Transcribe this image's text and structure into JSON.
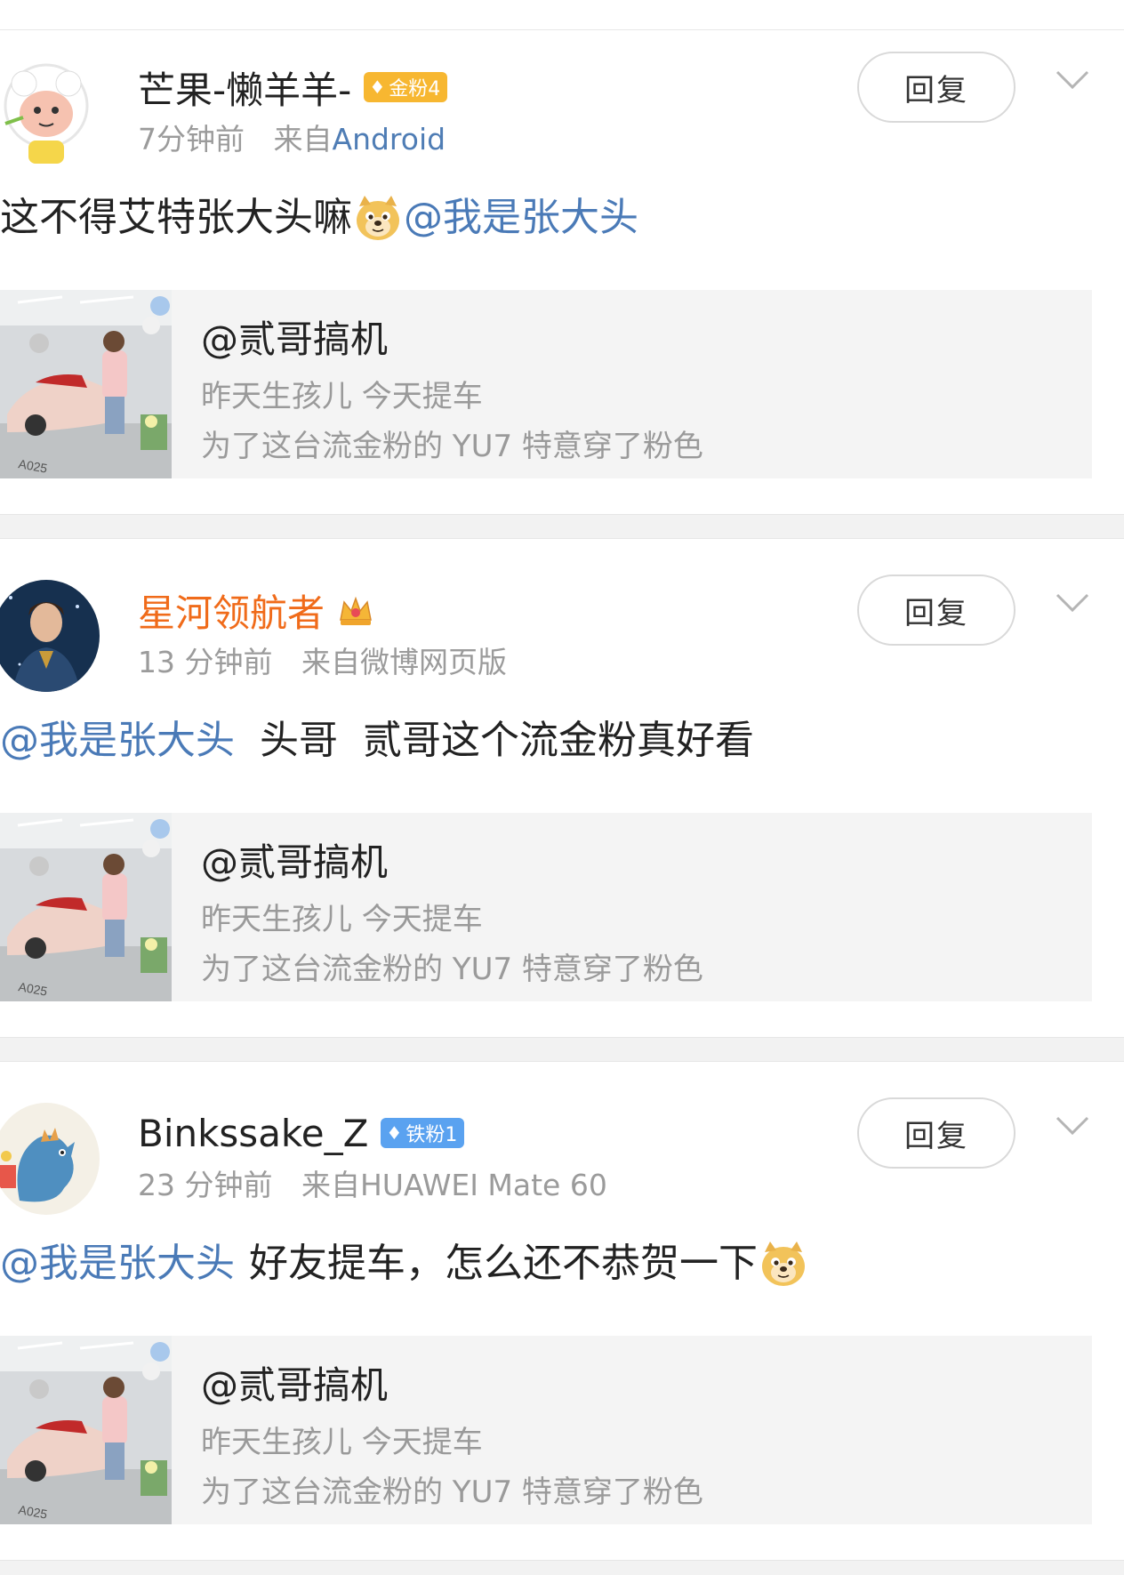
{
  "comments": [
    {
      "username": "芒果-懒羊羊-",
      "badge": "金粉4",
      "time": "7分钟前",
      "source_prefix": "来自",
      "source": "Android",
      "text_before": "这不得艾特张大头嘛",
      "mention": "@我是张大头",
      "text_after": "",
      "reply_label": "回复",
      "shared": {
        "title": "@贰哥搞机",
        "line1": "昨天生孩儿 今天提车",
        "line2": "为了这台流金粉的 YU7 特意穿了粉色"
      }
    },
    {
      "username": "星河领航者",
      "time": "13 分钟前",
      "source_prefix": "来自",
      "source": "微博网页版",
      "mention": "@我是张大头",
      "text_after": "头哥  贰哥这个流金粉真好看",
      "reply_label": "回复",
      "shared": {
        "title": "@贰哥搞机",
        "line1": "昨天生孩儿 今天提车",
        "line2": "为了这台流金粉的 YU7 特意穿了粉色"
      }
    },
    {
      "username": "Binkssake_Z",
      "badge": "铁粉1",
      "time": "23 分钟前",
      "source_prefix": "来自",
      "source": "HUAWEI Mate 60",
      "mention": "@我是张大头",
      "text_after": "好友提车，怎么还不恭贺一下",
      "reply_label": "回复",
      "shared": {
        "title": "@贰哥搞机",
        "line1": "昨天生孩儿 今天提车",
        "line2": "为了这台流金粉的 YU7 特意穿了粉色"
      }
    }
  ],
  "icons": {
    "badge_icon": "gem-icon",
    "emoji": "doge-emoji-icon",
    "expand": "chevron-down-icon",
    "vip": "crown-icon"
  },
  "colors": {
    "mention": "#4a7ab7",
    "vip_name": "#f06b1a",
    "gold_badge": "#f7b731",
    "iron_badge": "#5aa2f0"
  }
}
